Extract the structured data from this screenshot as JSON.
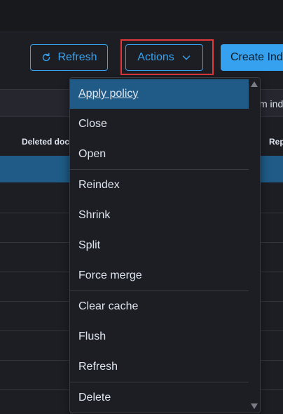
{
  "toolbar": {
    "refresh_label": "Refresh",
    "refresh_icon": "refresh-icon",
    "actions_label": "Actions",
    "actions_icon": "chevron-down-icon",
    "create_label": "Create Inde"
  },
  "filter": {
    "text": "m ind"
  },
  "table": {
    "headers": [
      "Deleted docu",
      "Rep"
    ]
  },
  "menu": {
    "items": [
      {
        "label": "Apply policy",
        "active": true
      },
      {
        "label": "Close"
      },
      {
        "label": "Open"
      },
      {
        "label": "Reindex"
      },
      {
        "label": "Shrink"
      },
      {
        "label": "Split"
      },
      {
        "label": "Force merge"
      },
      {
        "label": "Clear cache"
      },
      {
        "label": "Flush"
      },
      {
        "label": "Refresh"
      },
      {
        "label": "Delete"
      }
    ]
  },
  "colors": {
    "accent": "#36a2ef",
    "highlight": "#e0383b",
    "selected_row": "#1f5b86",
    "background": "#1d1e24"
  }
}
